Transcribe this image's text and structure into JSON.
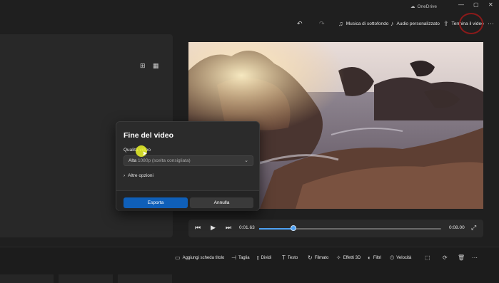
{
  "titlebar": {
    "onedrive_label": "OneDrive",
    "icons": [
      "cloud-icon",
      "minimize-icon",
      "maximize-icon",
      "close-icon"
    ]
  },
  "toolbar": {
    "music_label": "Musica di sottofondo",
    "audio_label": "Audio personalizzato",
    "finish_label": "Termina il video"
  },
  "player": {
    "current_time": "0:01.63",
    "total_time": "0:08.00",
    "progress": 0.19
  },
  "bottom_tools": [
    {
      "icon": "title-card-icon",
      "label": "Aggiungi scheda titolo"
    },
    {
      "icon": "trim-icon",
      "label": "Taglia"
    },
    {
      "icon": "split-icon",
      "label": "Dividi"
    },
    {
      "icon": "text-icon",
      "label": "Testo"
    },
    {
      "icon": "motion-icon",
      "label": "Filmato"
    },
    {
      "icon": "effects-3d-icon",
      "label": "Effetti 3D"
    },
    {
      "icon": "filters-icon",
      "label": "Filtri"
    },
    {
      "icon": "speed-icon",
      "label": "Velocità"
    }
  ],
  "dialog": {
    "title": "Fine del video",
    "quality_label": "Qualità video",
    "quality_value": "Alta",
    "quality_hint": "1080p (scelta consigliata)",
    "more_options": "Altre opzioni",
    "export_button": "Esporta",
    "cancel_button": "Annulla"
  },
  "colors": {
    "accent": "#0f5fb8",
    "progress": "#4ea1f3",
    "highlight_circle": "#8b1a1a",
    "cursor_highlight": "#ebf528"
  }
}
